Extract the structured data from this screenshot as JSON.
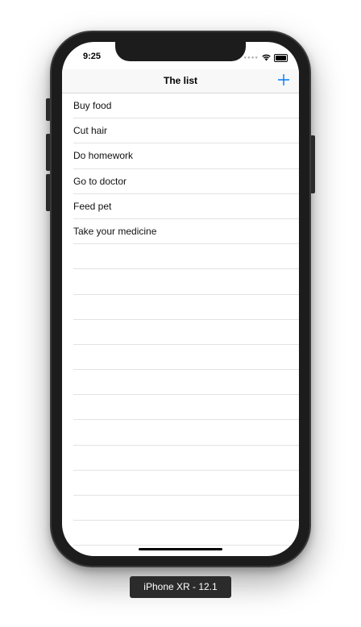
{
  "status_bar": {
    "time": "9:25"
  },
  "nav": {
    "title": "The list",
    "add_icon": "plus-icon",
    "accent_color": "#007aff"
  },
  "items": [
    {
      "label": "Buy food"
    },
    {
      "label": "Cut hair"
    },
    {
      "label": "Do homework"
    },
    {
      "label": "Go to doctor"
    },
    {
      "label": "Feed pet"
    },
    {
      "label": "Take your medicine"
    }
  ],
  "simulator": {
    "device_label": "iPhone XR - 12.1"
  }
}
